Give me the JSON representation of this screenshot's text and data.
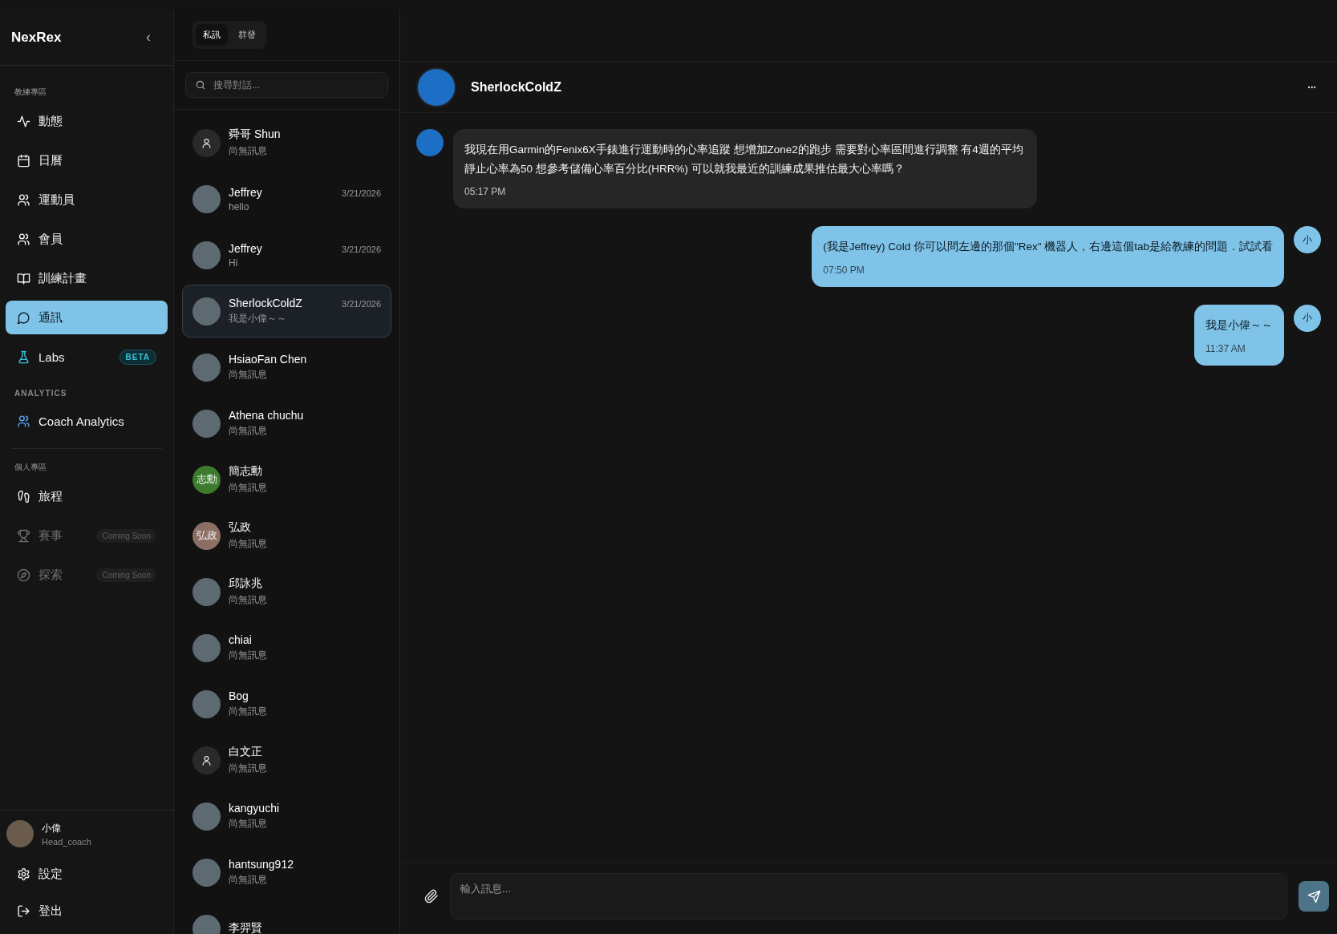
{
  "sidebar": {
    "brand": "NexRex",
    "collapse": "‹",
    "sections": [
      {
        "title": "教練專區",
        "items": [
          {
            "label": "動態",
            "selected": false,
            "disabled": false
          },
          {
            "label": "日曆",
            "selected": false,
            "disabled": false
          },
          {
            "label": "運動員",
            "selected": false,
            "disabled": false
          },
          {
            "label": "會員",
            "selected": false,
            "disabled": false
          },
          {
            "label": "訓練計畫",
            "selected": false,
            "disabled": false
          },
          {
            "label": "通訊",
            "selected": true,
            "disabled": false
          },
          {
            "label": "Labs",
            "selected": false,
            "disabled": false,
            "badge": "BETA"
          }
        ]
      },
      {
        "title": "ANALYTICS",
        "items": [
          {
            "label": "Coach Analytics",
            "selected": false,
            "disabled": false
          }
        ]
      },
      {
        "title": "個人專區",
        "items": [
          {
            "label": "旅程",
            "selected": false,
            "disabled": false
          },
          {
            "label": "賽事",
            "selected": false,
            "disabled": true,
            "badge": "Coming Soon"
          },
          {
            "label": "探索",
            "selected": false,
            "disabled": true,
            "badge": "Coming Soon"
          }
        ]
      }
    ],
    "user": {
      "name": "小偉",
      "role": "Head_coach"
    },
    "footer": [
      {
        "label": "設定"
      },
      {
        "label": "登出"
      }
    ]
  },
  "conversations": {
    "tabs": [
      {
        "label": "私訊",
        "selected": true
      },
      {
        "label": "群發",
        "selected": false
      }
    ],
    "search": {
      "placeholder": "搜尋對話..."
    },
    "items": [
      {
        "name": "舜哥 Shun",
        "preview": "尚無訊息",
        "avatar": {
          "kind": "default"
        },
        "selected": false
      },
      {
        "name": "Jeffrey",
        "preview": "hello",
        "date": "3/21/2026",
        "avatar": {
          "kind": "photo"
        },
        "selected": false
      },
      {
        "name": "Jeffrey",
        "preview": "Hi",
        "date": "3/21/2026",
        "avatar": {
          "kind": "photo"
        },
        "selected": false
      },
      {
        "name": "SherlockColdZ",
        "preview": "我是小偉～～",
        "date": "3/21/2026",
        "avatar": {
          "kind": "photo"
        },
        "selected": true
      },
      {
        "name": "HsiaoFan Chen",
        "preview": "尚無訊息",
        "avatar": {
          "kind": "photo"
        },
        "selected": false
      },
      {
        "name": "Athena chuchu",
        "preview": "尚無訊息",
        "avatar": {
          "kind": "photo"
        },
        "selected": false
      },
      {
        "name": "簡志勳",
        "preview": "尚無訊息",
        "avatar": {
          "kind": "initials",
          "text": "志勳",
          "color": "#3c7a2c"
        },
        "selected": false
      },
      {
        "name": "弘政",
        "preview": "尚無訊息",
        "avatar": {
          "kind": "initials",
          "text": "弘政",
          "color": "#8d6e63"
        },
        "selected": false
      },
      {
        "name": "邱詠兆",
        "preview": "尚無訊息",
        "avatar": {
          "kind": "photo"
        },
        "selected": false
      },
      {
        "name": "chiai",
        "preview": "尚無訊息",
        "avatar": {
          "kind": "photo"
        },
        "selected": false
      },
      {
        "name": "Bog",
        "preview": "尚無訊息",
        "avatar": {
          "kind": "photo"
        },
        "selected": false
      },
      {
        "name": "白文正",
        "preview": "尚無訊息",
        "avatar": {
          "kind": "default"
        },
        "selected": false
      },
      {
        "name": "kangyuchi",
        "preview": "尚無訊息",
        "avatar": {
          "kind": "photo"
        },
        "selected": false
      },
      {
        "name": "hantsung912",
        "preview": "尚無訊息",
        "avatar": {
          "kind": "photo"
        },
        "selected": false
      },
      {
        "name": "李羿賢",
        "avatar": {
          "kind": "photo"
        },
        "selected": false
      }
    ]
  },
  "chat": {
    "title": "SherlockColdZ",
    "more": "···",
    "messages": [
      {
        "kind": "incoming",
        "text": "我現在用Garmin的Fenix6X手錶進行運動時的心率追蹤 想增加Zone2的跑步 需要對心率區間進行調整 有4週的平均靜止心率為50 想參考儲備心率百分比(HRR%) 可以就我最近的訓練成果推估最大心率嗎？",
        "time": "05:17 PM"
      },
      {
        "kind": "outgoing",
        "text": "(我是Jeffrey) Cold 你可以問左邊的那個\"Rex\" 機器人，右邊這個tab是給教練的問題．試試看",
        "time": "07:50 PM",
        "avatar": "小"
      },
      {
        "kind": "outgoing",
        "text": "我是小偉～～",
        "time": "11:37 AM",
        "avatar": "小"
      }
    ],
    "input": {
      "placeholder": "輸入訊息..."
    }
  }
}
